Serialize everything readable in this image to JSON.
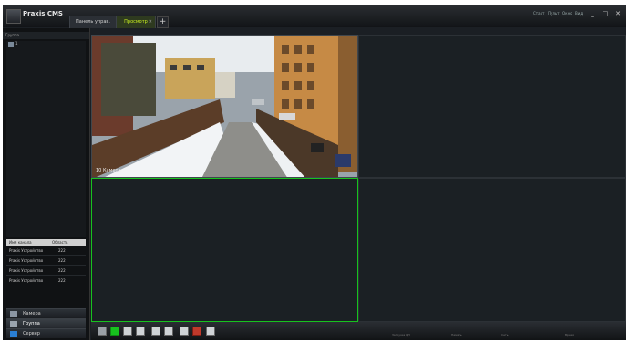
{
  "app": {
    "title": "Praxis CMS",
    "tabs": [
      {
        "label": "Панель управ."
      },
      {
        "label": "Просмотр"
      }
    ],
    "add_tab_label": "+",
    "menu": [
      "Старт",
      "Пульт",
      "Окно",
      "Вид"
    ],
    "window_buttons": [
      "_",
      "□",
      "✕"
    ]
  },
  "left_panel": {
    "header": "Группа",
    "tree_item": "1",
    "device_table": {
      "headers": [
        "Имя канала",
        "Область"
      ],
      "rows": [
        [
          "Praxis Устройство",
          "222"
        ],
        [
          "Praxis Устройство",
          "222"
        ],
        [
          "Praxis Устройство",
          "222"
        ],
        [
          "Praxis Устройство",
          "222"
        ]
      ]
    },
    "nav_buttons": [
      {
        "label": "Камера",
        "icon": "camera-icon"
      },
      {
        "label": "Группа",
        "icon": "group-icon"
      },
      {
        "label": "Сервер",
        "icon": "server-icon"
      }
    ]
  },
  "viewer": {
    "camera_label": "10 Камера"
  },
  "toolbar": {
    "buttons": [
      "single-layout-icon",
      "grid-4-icon",
      "grid-9-icon",
      "grid-16-icon",
      "grid-25-icon",
      "grid-36-icon",
      "record-icon",
      "snapshot-icon",
      "fullscreen-icon"
    ],
    "accent": "#17c21e"
  },
  "status": [
    "Загрузка ЦП",
    "Память",
    "Сеть",
    "Время"
  ]
}
